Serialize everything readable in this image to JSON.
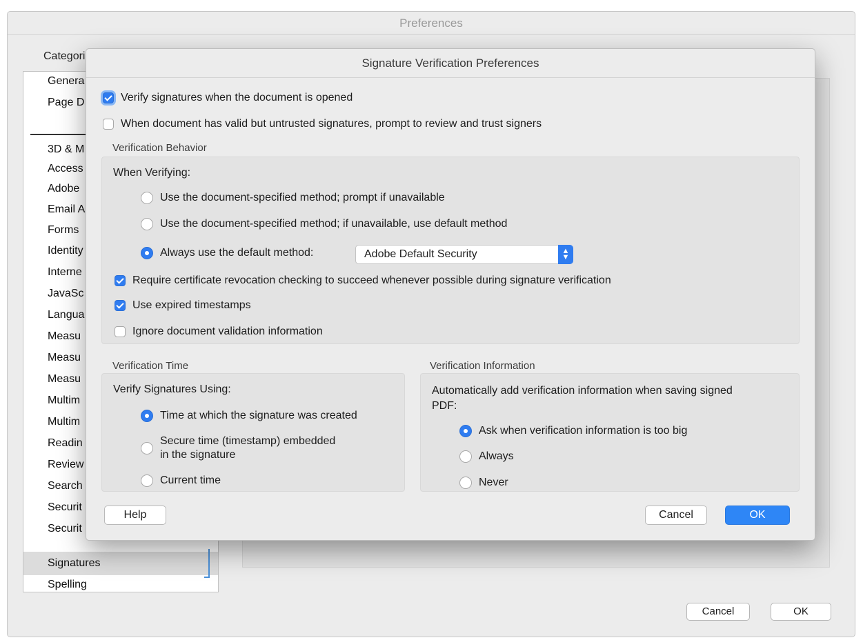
{
  "prefs": {
    "title": "Preferences",
    "categories_label": "Categories",
    "categories": [
      "Genera",
      "Page D",
      "3D & M",
      "Access",
      "Adobe",
      "Email A",
      "Forms",
      "Identity",
      "Interne",
      "JavaSc",
      "Langua",
      "Measu",
      "Measu",
      "Measu",
      "Multim",
      "Multim",
      "Readin",
      "Review",
      "Search",
      "Securit",
      "Securit",
      "Signatures",
      "Spelling"
    ],
    "selected_category": "Signatures",
    "cancel_label": "Cancel",
    "ok_label": "OK"
  },
  "dialog": {
    "title": "Signature Verification Preferences",
    "verify_on_open": {
      "label": "Verify signatures when the document is opened",
      "checked": true
    },
    "prompt_untrusted": {
      "label": "When document has valid but untrusted signatures, prompt to review and trust signers",
      "checked": false
    },
    "behavior": {
      "heading": "Verification Behavior",
      "when_verifying": "When Verifying:",
      "options": [
        {
          "label": "Use the document-specified method; prompt if unavailable",
          "selected": false
        },
        {
          "label": "Use the document-specified method; if unavailable, use default method",
          "selected": false
        },
        {
          "label": "Always use the default method:",
          "selected": true
        }
      ],
      "default_method": "Adobe Default Security",
      "require_revocation": {
        "label": "Require certificate revocation checking to succeed whenever possible during signature verification",
        "checked": true
      },
      "use_expired": {
        "label": "Use expired timestamps",
        "checked": true
      },
      "ignore_validation": {
        "label": "Ignore document validation information",
        "checked": false
      }
    },
    "time": {
      "heading": "Verification Time",
      "sub": "Verify Signatures Using:",
      "options": [
        {
          "label": "Time at which the signature was created",
          "selected": true
        },
        {
          "label1": "Secure time (timestamp) embedded",
          "label2": "in the signature",
          "selected": false
        },
        {
          "label": "Current time",
          "selected": false
        }
      ]
    },
    "info": {
      "heading": "Verification Information",
      "sub1": "Automatically add verification information when saving signed",
      "sub2": "PDF:",
      "options": [
        {
          "label": "Ask when verification information is too big",
          "selected": true
        },
        {
          "label": "Always",
          "selected": false
        },
        {
          "label": "Never",
          "selected": false
        }
      ]
    },
    "help_label": "Help",
    "cancel_label": "Cancel",
    "ok_label": "OK"
  }
}
